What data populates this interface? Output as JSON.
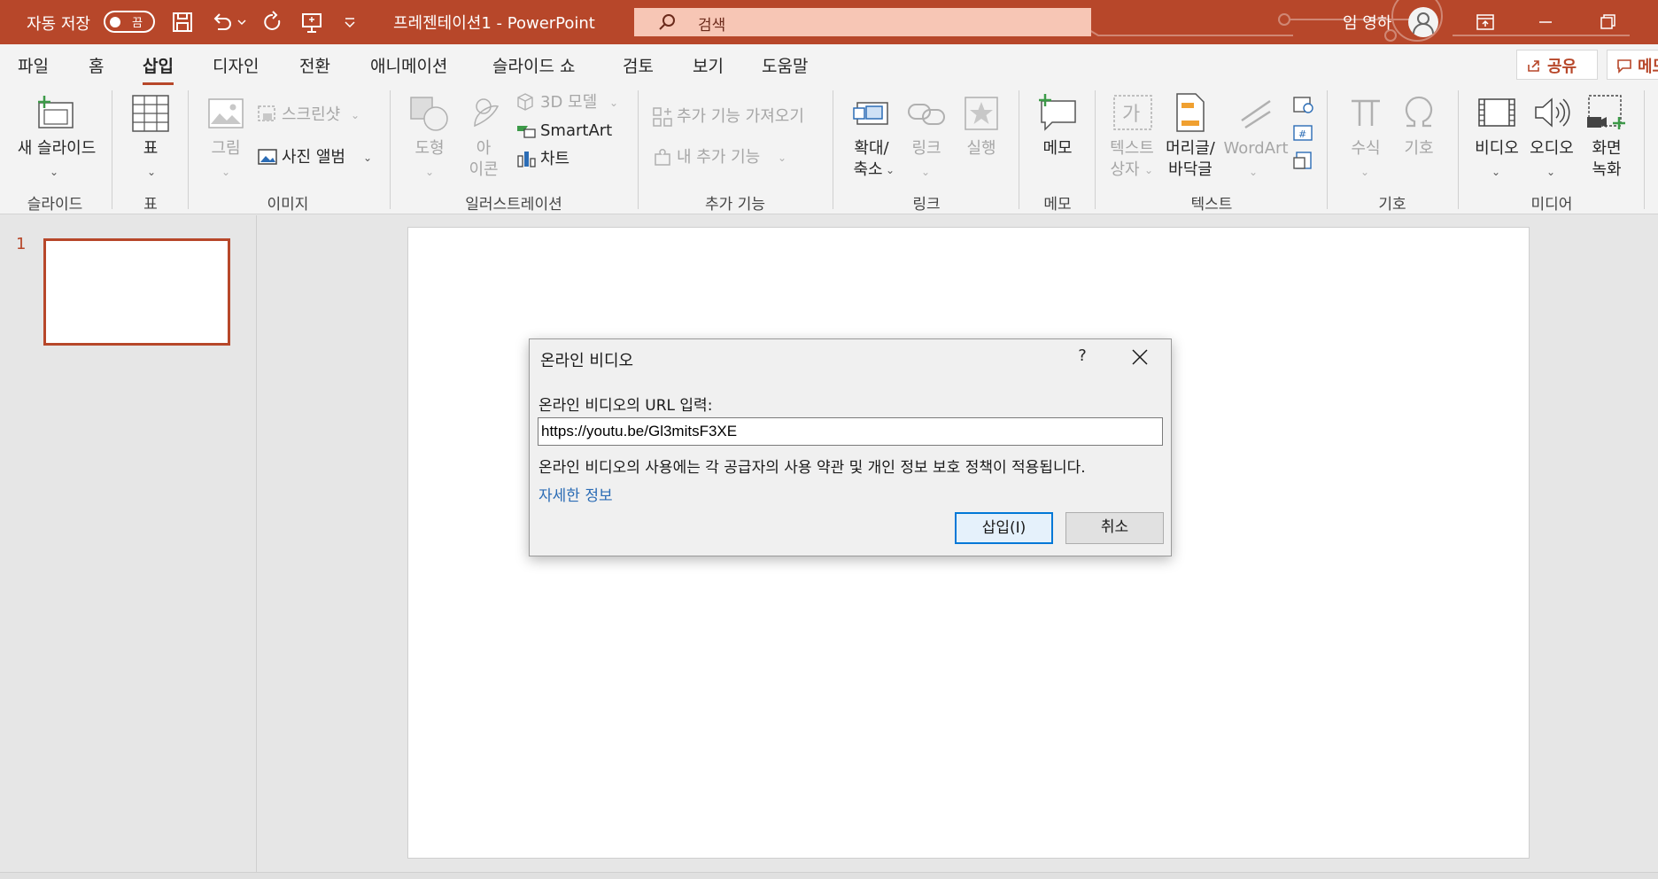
{
  "titlebar": {
    "autosave_label": "자동 저장",
    "autosave_state": "끔",
    "doc_title": "프레젠테이션1  -  PowerPoint",
    "search_placeholder": "검색",
    "user_name": "임 영하",
    "bg_color": "#b7472a"
  },
  "menu": {
    "tabs": [
      "파일",
      "홈",
      "삽입",
      "디자인",
      "전환",
      "애니메이션",
      "슬라이드 쇼",
      "검토",
      "보기",
      "도움말"
    ],
    "active_tab": "삽입",
    "share_label": "공유",
    "comment_label": "메모"
  },
  "ribbon": {
    "new_slide": "새 슬라이드",
    "table": "표",
    "picture": "그림",
    "screenshot": "스크린샷",
    "photo_album": "사진 앨범",
    "shapes": "도형",
    "icons_line1": "아",
    "icons_line2": "이콘",
    "models_3d": "3D 모델",
    "smartart": "SmartArt",
    "chart": "차트",
    "get_addins": "추가 기능 가져오기",
    "my_addins": "내 추가 기능",
    "zoom_line1": "확대/",
    "zoom_line2": "축소",
    "link": "링크",
    "action": "실행",
    "comment": "메모",
    "textbox_line1": "텍스트",
    "textbox_line2": "상자",
    "headerfooter_line1": "머리글/",
    "headerfooter_line2": "바닥글",
    "wordart": "WordArt",
    "equation": "수식",
    "symbol": "기호",
    "video": "비디오",
    "audio": "오디오",
    "record_line1": "화면",
    "record_line2": "녹화",
    "groups": {
      "slides": "슬라이드",
      "tables": "표",
      "images": "이미지",
      "illustrations": "일러스트레이션",
      "addins": "추가 기능",
      "links": "링크",
      "comments": "메모",
      "text": "텍스트",
      "symbols": "기호",
      "media": "미디어"
    }
  },
  "slides_pane": {
    "slide_number": "1"
  },
  "dialog": {
    "title": "온라인 비디오",
    "help": "?",
    "url_label": "온라인 비디오의 URL 입력:",
    "url_value": "https://youtu.be/Gl3mitsF3XE",
    "note": "온라인 비디오의 사용에는 각 공급자의 사용 약관 및 개인 정보 보호 정책이 적용됩니다.",
    "more_info_link": "자세한 정보",
    "insert_button": "삽입(I)",
    "cancel_button": "취소"
  }
}
